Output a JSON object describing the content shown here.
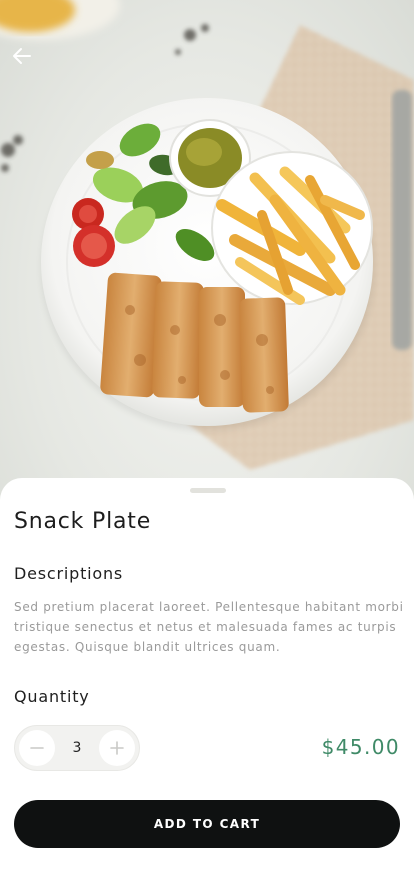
{
  "product": {
    "title": "Snack Plate",
    "image": "snack-plate-photo"
  },
  "navigation": {
    "back_icon": "arrow-left-icon"
  },
  "description": {
    "heading": "Descriptions",
    "text": "Sed pretium placerat laoreet. Pellentesque habitant morbi tristique senectus et netus et malesuada fames ac turpis egestas. Quisque blandit ultrices quam."
  },
  "quantity": {
    "heading": "Quantity",
    "value": "3",
    "minus_icon": "minus-icon",
    "plus_icon": "plus-icon"
  },
  "price": "$45.00",
  "cart_button": {
    "label": "ADD TO CART"
  },
  "colors": {
    "price": "#3f8a67",
    "button": "#0f1111"
  }
}
